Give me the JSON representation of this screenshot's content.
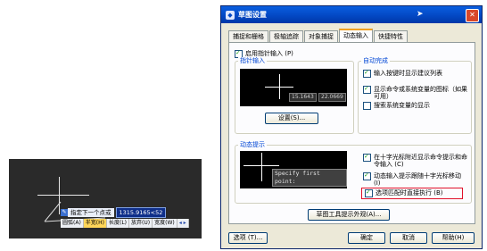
{
  "cad_viewport": {
    "prompt_icon": "dynamic-input-icon",
    "prompt_text": "指定下一个点或",
    "coordinate_value": "1315.9165<52",
    "options": [
      {
        "label": "圆弧(A)",
        "selected": false
      },
      {
        "label": "半宽(H)",
        "selected": true
      },
      {
        "label": "长度(L)",
        "selected": false
      },
      {
        "label": "放弃(U)",
        "selected": false
      },
      {
        "label": "宽度(W)",
        "selected": false
      }
    ],
    "more_arrow": "◂ ▸"
  },
  "dialog": {
    "title": "草图设置",
    "title_icon": "app-icon",
    "close_glyph": "✕",
    "tabs": [
      {
        "label": "捕捉和栅格",
        "active": false
      },
      {
        "label": "极轴追踪",
        "active": false
      },
      {
        "label": "对象捕捉",
        "active": false
      },
      {
        "label": "动态输入",
        "active": true
      },
      {
        "label": "快捷特性",
        "active": false
      }
    ],
    "enable_pointer_input": {
      "label": "启用指针输入 (P)",
      "checked": true
    },
    "pointer_input": {
      "group_title": "指针输入",
      "coord_x": "15.1643",
      "coord_y": "22.0669",
      "settings_button": "设置(S)..."
    },
    "dimension_input": {
      "group_title": "自动完成",
      "items": [
        {
          "label": "输入按键时显示建议列表",
          "checked": true
        },
        {
          "label": "显示命令或系统变量的图标（如果可用）",
          "checked": true
        },
        {
          "label": "搜索系统变量的显示",
          "checked": false
        }
      ]
    },
    "dynamic_prompts": {
      "group_title": "动态提示",
      "tooltip_text": "Specify first point:",
      "items": [
        {
          "label": "在十字光标附近显示命令提示和命令输入 (C)",
          "checked": true
        },
        {
          "label": "动态输入提示跟随十字光标移动 (I)",
          "checked": true
        },
        {
          "label": "选项匹配时直接执行 (B)",
          "checked": true,
          "highlighted": true
        }
      ]
    },
    "tooltip_appearance_button": "草图工具提示外观(A)...",
    "footer": {
      "options_button": "选项 (T)...",
      "ok_button": "确定",
      "cancel_button": "取消",
      "help_button": "帮助(H)"
    },
    "highlight_color": "#e0102a"
  }
}
